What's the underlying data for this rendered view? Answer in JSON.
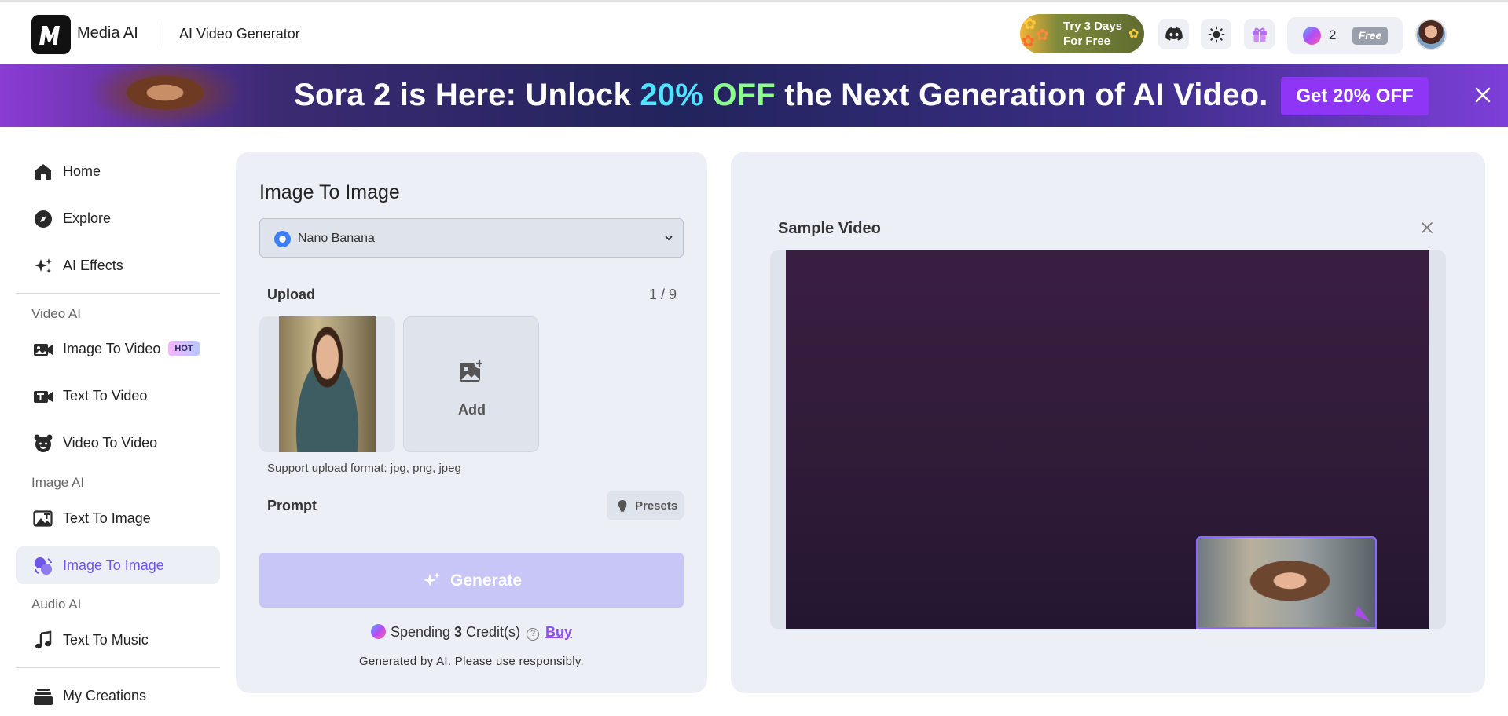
{
  "header": {
    "brand": "Media AI",
    "page_name": "AI Video Generator",
    "trial_line1": "Try 3 Days",
    "trial_line2": "For Free",
    "credits_count": "2",
    "plan_badge": "Free",
    "icons": [
      "discord-icon",
      "sun-icon",
      "gift-icon"
    ]
  },
  "promo": {
    "text_before": "Sora 2 is Here: Unlock ",
    "highlight1": "20%",
    "highlight2": " OFF",
    "text_after": " the Next Generation of AI Video.",
    "button": "Get 20% OFF"
  },
  "sidebar": {
    "items": [
      {
        "label": "Home",
        "icon": "home-icon"
      },
      {
        "label": "Explore",
        "icon": "compass-icon"
      },
      {
        "label": "AI Effects",
        "icon": "sparkle-icon"
      }
    ],
    "video_section": "Video AI",
    "video_items": [
      {
        "label": "Image To Video",
        "badge": "HOT"
      },
      {
        "label": "Text To Video"
      },
      {
        "label": "Video To Video"
      }
    ],
    "image_section": "Image AI",
    "image_items": [
      {
        "label": "Text To Image"
      },
      {
        "label": "Image To Image",
        "active": true
      }
    ],
    "audio_section": "Audio AI",
    "audio_items": [
      {
        "label": "Text To Music"
      }
    ],
    "creations": "My Creations"
  },
  "form": {
    "title": "Image To Image",
    "model": "Nano Banana",
    "upload_label": "Upload",
    "upload_count": "1 / 9",
    "add_label": "Add",
    "support_text": "Support upload format: jpg, png, jpeg",
    "prompt_label": "Prompt",
    "presets_label": "Presets",
    "generate_label": "Generate",
    "spending_prefix": "Spending ",
    "spending_amount": "3",
    "spending_suffix": " Credit(s)",
    "buy_label": "Buy",
    "disclaimer": "Generated by AI. Please use responsibly."
  },
  "sample": {
    "title": "Sample Video"
  },
  "colors": {
    "accent": "#6e55e8",
    "generate_disabled": "#c8c6f6",
    "promo_button": "#8f35f5"
  }
}
